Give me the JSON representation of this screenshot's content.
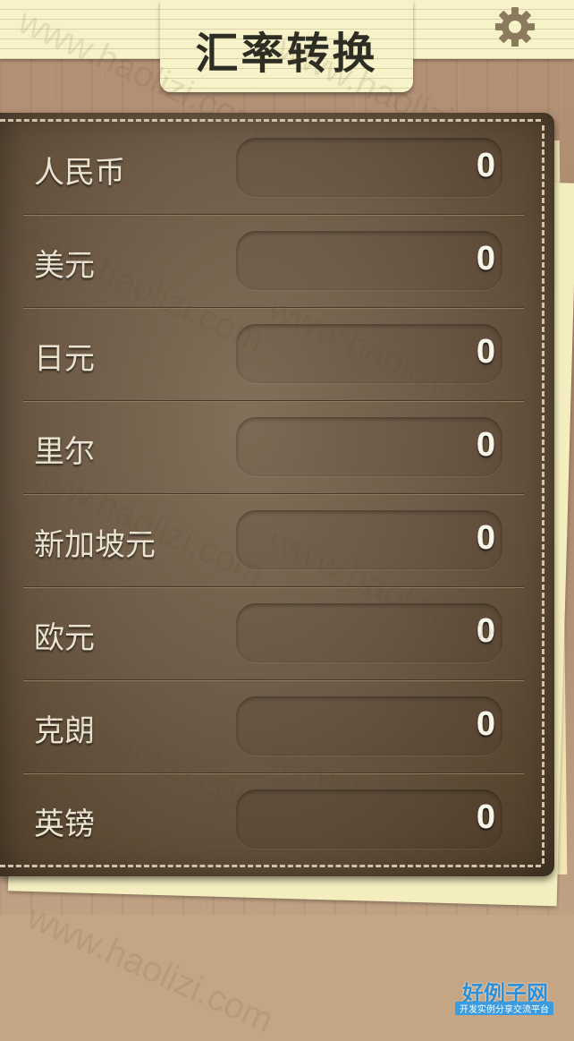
{
  "header": {
    "title": "汇率转换",
    "settings_icon": "gear-icon"
  },
  "currencies": [
    {
      "label": "人民币",
      "value": "0"
    },
    {
      "label": "美元",
      "value": "0"
    },
    {
      "label": "日元",
      "value": "0"
    },
    {
      "label": "里尔",
      "value": "0"
    },
    {
      "label": "新加坡元",
      "value": "0"
    },
    {
      "label": "欧元",
      "value": "0"
    },
    {
      "label": "克朗",
      "value": "0"
    },
    {
      "label": "英镑",
      "value": "0"
    }
  ],
  "watermark": "www.haolizi.com",
  "brand": {
    "name": "好例子网",
    "tagline": "开发实例分享交流平台"
  },
  "colors": {
    "leather": "#6e5b47",
    "paper": "#f7f2c8",
    "label_text": "#ebe3d2",
    "brand_blue": "#2c8fd6"
  }
}
